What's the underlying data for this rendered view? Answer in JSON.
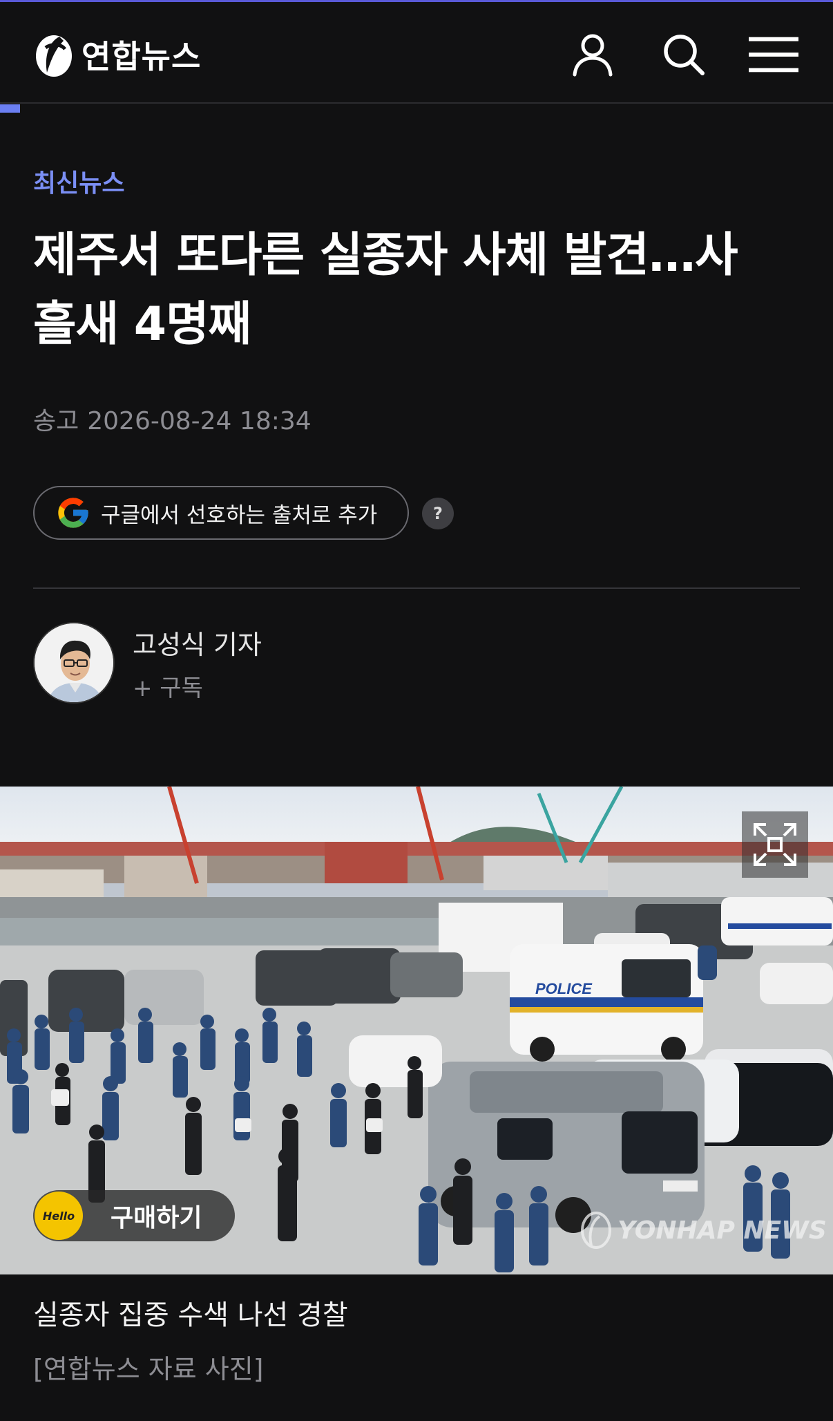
{
  "header": {
    "logo_text": "연합뉴스",
    "icons": [
      "user-icon",
      "search-icon",
      "menu-icon"
    ]
  },
  "article": {
    "category": "최신뉴스",
    "headline_line1": "제주서 또다른 실종자 사체 발견…사",
    "headline_line2": "흘새 4명째",
    "sent_label": "송고",
    "sent_datetime": "2026-08-24 18:34",
    "google_pref_button": "구글에서 선호하는 출처로 추가",
    "help_label": "?",
    "author_name": "고성식 기자",
    "subscribe_label": "+ 구독"
  },
  "photo": {
    "buy_badge": "Hello",
    "buy_label": "구매하기",
    "watermark": "YONHAP NEWS",
    "caption": "실종자 집중 수색 나선 경찰",
    "source": "[연합뉴스 자료 사진]",
    "vehicle_text": "POLICE"
  },
  "colors": {
    "background": "#111112",
    "accent": "#7b8ff5",
    "muted_text": "#8d8d93"
  }
}
